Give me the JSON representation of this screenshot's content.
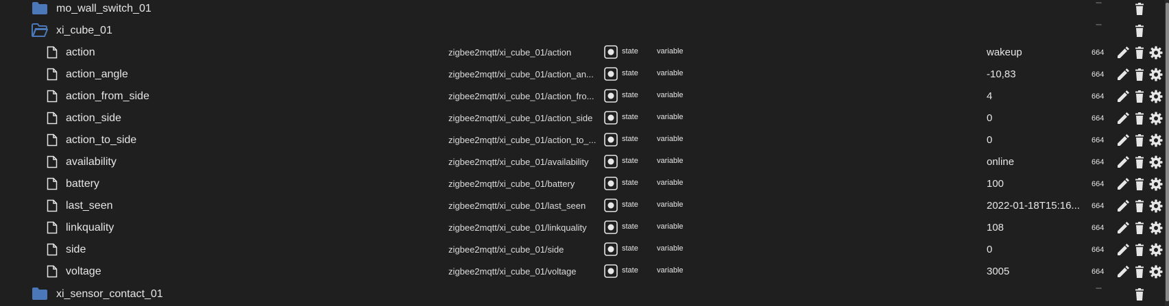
{
  "folder_top": {
    "name": "mo_wall_switch_01",
    "acl": "---"
  },
  "folder_open": {
    "name": "xi_cube_01",
    "acl": "---"
  },
  "states": [
    {
      "name": "action",
      "id": "zigbee2mqtt/xi_cube_01/action",
      "type": "state",
      "role": "variable",
      "value": "wakeup",
      "acl": "664"
    },
    {
      "name": "action_angle",
      "id": "zigbee2mqtt/xi_cube_01/action_an...",
      "type": "state",
      "role": "variable",
      "value": "-10,83",
      "acl": "664"
    },
    {
      "name": "action_from_side",
      "id": "zigbee2mqtt/xi_cube_01/action_fro...",
      "type": "state",
      "role": "variable",
      "value": "4",
      "acl": "664"
    },
    {
      "name": "action_side",
      "id": "zigbee2mqtt/xi_cube_01/action_side",
      "type": "state",
      "role": "variable",
      "value": "0",
      "acl": "664"
    },
    {
      "name": "action_to_side",
      "id": "zigbee2mqtt/xi_cube_01/action_to_...",
      "type": "state",
      "role": "variable",
      "value": "0",
      "acl": "664"
    },
    {
      "name": "availability",
      "id": "zigbee2mqtt/xi_cube_01/availability",
      "type": "state",
      "role": "variable",
      "value": "online",
      "acl": "664"
    },
    {
      "name": "battery",
      "id": "zigbee2mqtt/xi_cube_01/battery",
      "type": "state",
      "role": "variable",
      "value": "100",
      "acl": "664"
    },
    {
      "name": "last_seen",
      "id": "zigbee2mqtt/xi_cube_01/last_seen",
      "type": "state",
      "role": "variable",
      "value": "2022-01-18T15:16...",
      "acl": "664"
    },
    {
      "name": "linkquality",
      "id": "zigbee2mqtt/xi_cube_01/linkquality",
      "type": "state",
      "role": "variable",
      "value": "108",
      "acl": "664"
    },
    {
      "name": "side",
      "id": "zigbee2mqtt/xi_cube_01/side",
      "type": "state",
      "role": "variable",
      "value": "0",
      "acl": "664"
    },
    {
      "name": "voltage",
      "id": "zigbee2mqtt/xi_cube_01/voltage",
      "type": "state",
      "role": "variable",
      "value": "3005",
      "acl": "664"
    }
  ],
  "folder_bottom": {
    "name": "xi_sensor_contact_01",
    "acl": "---"
  },
  "colors": {
    "background": "#1f1f1f",
    "folder": "#4a78b8",
    "text": "#e6e6e6"
  }
}
